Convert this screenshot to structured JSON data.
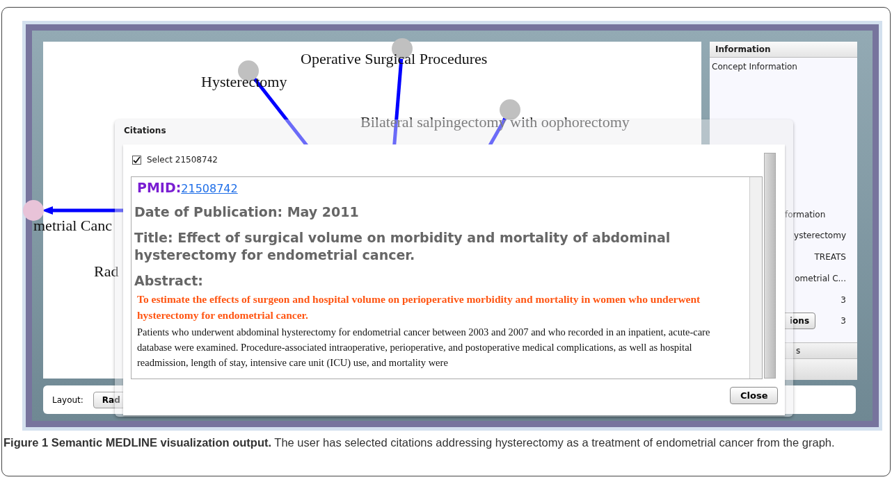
{
  "graph": {
    "labels": [
      "Operative Surgical Procedures",
      "Hysterectomy",
      "Bilateral salpingectomy with oophorectomy",
      "metrial Canc",
      "Rad"
    ],
    "nodes": [
      {
        "color": "#c0c0c0"
      },
      {
        "color": "#c0c0c0"
      },
      {
        "color": "#c0c0c0"
      },
      {
        "color": "#e8c3d8"
      }
    ]
  },
  "information": {
    "title": "Information",
    "concept_label": "Concept Information",
    "rows": [
      "formation",
      "ysterectomy",
      "TREATS",
      "ometrial C...",
      "3"
    ],
    "button": "ions",
    "count": "3",
    "tab": "s"
  },
  "toolbar": {
    "layout_label": "Layout:",
    "layout_button": "Rad"
  },
  "citations_dialog": {
    "title": "Citations",
    "select": {
      "label": "Select 21508742",
      "checked": true
    },
    "pmid_label": "PMID:",
    "pmid_link": "21508742",
    "date": "Date of Publication: May 2011",
    "article_title": "Title: Effect of surgical volume on morbidity and mortality of abdominal hysterectomy for endometrial cancer.",
    "abstract_label": "Abstract:",
    "objective": "To estimate the effects of surgeon and hospital volume on perioperative morbidity and mortality in women who underwent hysterectomy for endometrial cancer.",
    "methods": "Patients who underwent abdominal hysterectomy for endometrial cancer between 2003 and 2007 and who recorded in an inpatient, acute-care database were examined. Procedure-associated intraoperative, perioperative, and postoperative medical complications, as well as hospital readmission, length of stay, intensive care unit (ICU) use, and mortality were",
    "close_button": "Close"
  },
  "caption": "**Figure 1 Semantic MEDLINE visualization output.** The user has selected citations addressing hysterectomy as a treatment of endometrial cancer from the graph."
}
